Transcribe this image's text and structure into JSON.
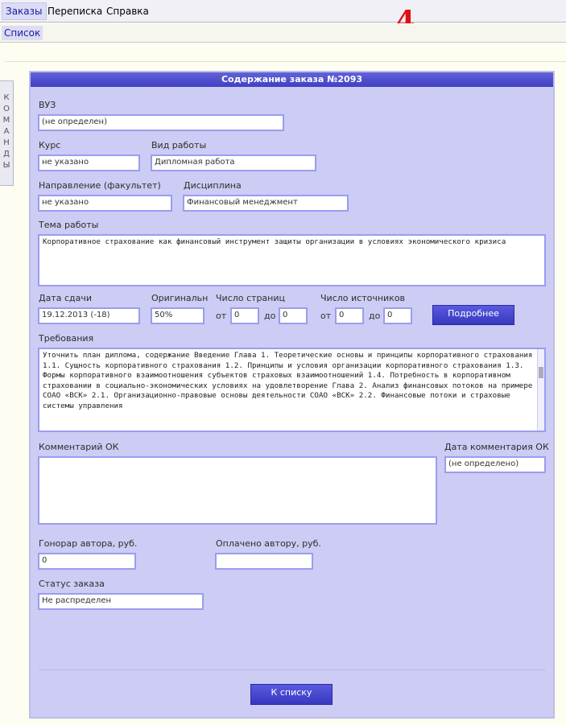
{
  "topmenu": {
    "items": [
      "Заказы",
      "Переписка",
      "Справка"
    ],
    "page_number": "4"
  },
  "submenu": {
    "items": [
      "Список"
    ]
  },
  "sidetab": {
    "label": [
      "К",
      "О",
      "М",
      "А",
      "Н",
      "Д",
      "Ы"
    ]
  },
  "panel": {
    "title": "Содержание заказа №2093"
  },
  "form": {
    "vuz": {
      "label": "ВУЗ",
      "value": "(не определен)"
    },
    "course": {
      "label": "Курс",
      "value": "не указано"
    },
    "work_type": {
      "label": "Вид работы",
      "value": "Дипломная работа"
    },
    "faculty": {
      "label": "Направление (факультет)",
      "value": "не указано"
    },
    "discipline": {
      "label": "Дисциплина",
      "value": "Финансовый менеджмент"
    },
    "topic": {
      "label": "Тема работы",
      "value": "Корпоративное страхование как финансовый инструмент защиты организации в условиях экономического кризиса"
    },
    "due_date": {
      "label": "Дата сдачи",
      "value": "19.12.2013 (-18)"
    },
    "originality": {
      "label": "Оригинальность",
      "value": "50%"
    },
    "pages": {
      "label": "Число страниц",
      "from_label": "от",
      "from": "0",
      "to_label": "до",
      "to": "0"
    },
    "sources": {
      "label": "Число источников",
      "from_label": "от",
      "from": "0",
      "to_label": "до",
      "to": "0"
    },
    "info_button": "Подробнее",
    "requirements": {
      "label": "Требования",
      "value": "  Уточнить план диплома, содержание Введение Глава 1. Теоретические основы и принципы корпоративного страхования 1.1. Сущность корпоративного страхования 1.2. Принципы и условия организации корпоративного страхования 1.3. Формы корпоративного взаимоотношения субъектов страховых взаимоотношений 1.4. Потребность в корпоративном страховании в социально-экономических условиях на удовлетворение Глава 2. Анализ финансовых потоков на примере СОАО «ВСК» 2.1. Организационно-правовые основы деятельности СОАО «ВСК» 2.2. Финансовые потоки и страховые системы управления"
    },
    "comment_ok": {
      "label": "Комментарий ОК",
      "value": ""
    },
    "comment_date": {
      "label": "Дата комментария ОК",
      "value": "(не определено)"
    },
    "fee": {
      "label": "Гонорар автора, руб.",
      "value": "0"
    },
    "paid": {
      "label": "Оплачено автору, руб.",
      "value": ""
    },
    "status": {
      "label": "Статус заказа",
      "value": "Не распределен"
    },
    "back_button": "К списку"
  }
}
